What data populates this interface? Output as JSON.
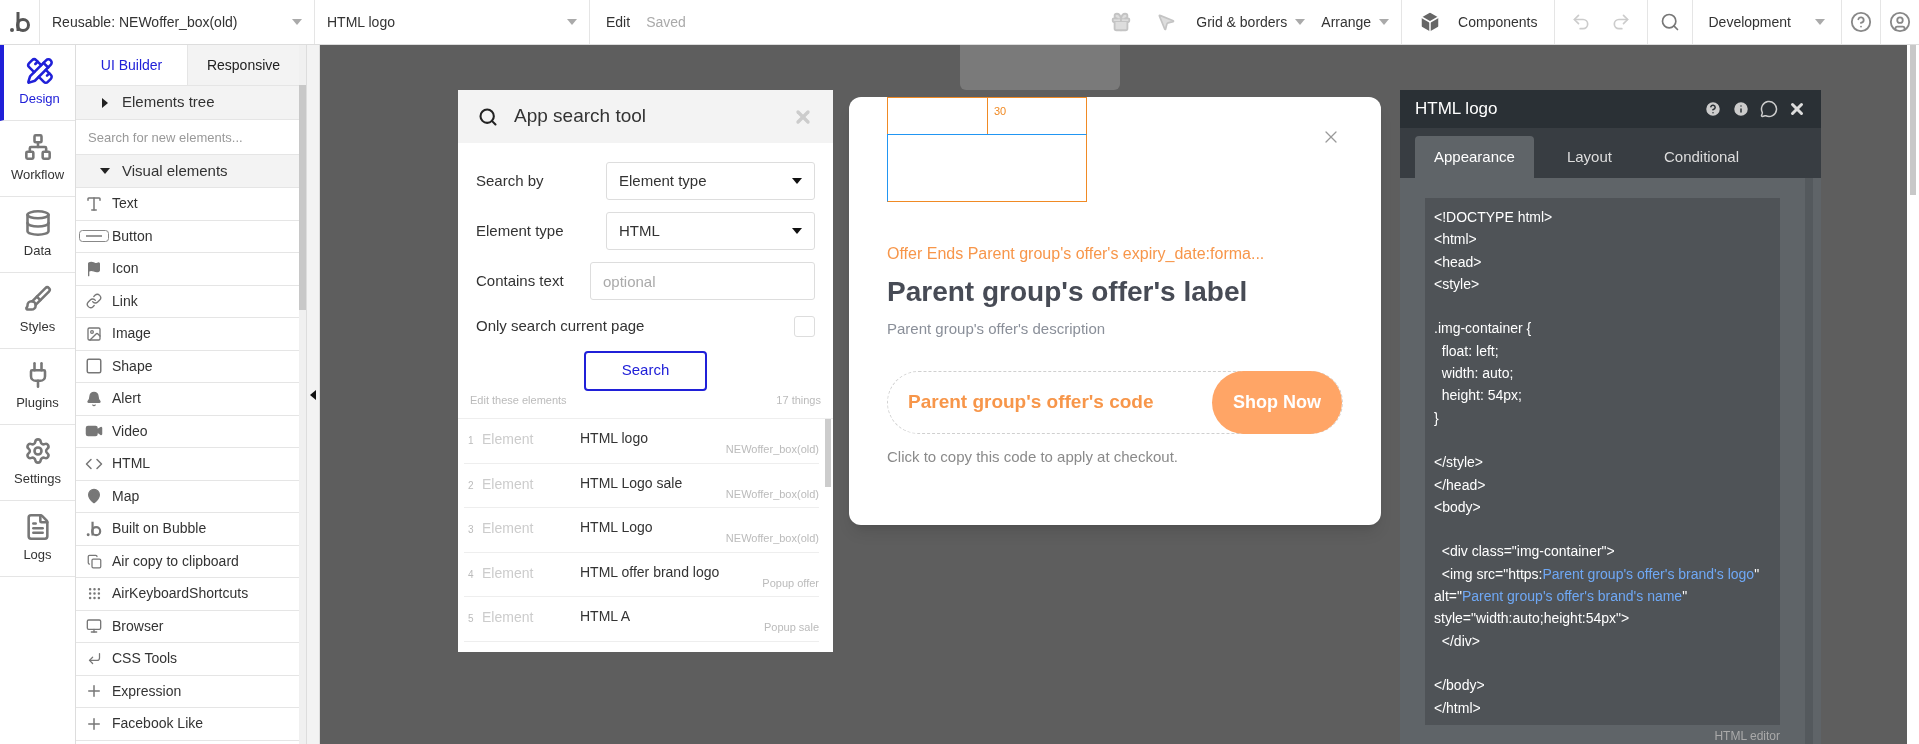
{
  "top_bar": {
    "reusable_dropdown": "Reusable: NEWoffer_box(old)",
    "element_dropdown": "HTML logo",
    "edit": "Edit",
    "save_status": "Saved",
    "grid_menu": "Grid & borders",
    "arrange_menu": "Arrange",
    "components": "Components",
    "environment": "Development"
  },
  "rail": [
    {
      "label": "Design",
      "selected": true
    },
    {
      "label": "Workflow",
      "selected": false
    },
    {
      "label": "Data",
      "selected": false
    },
    {
      "label": "Styles",
      "selected": false
    },
    {
      "label": "Plugins",
      "selected": false
    },
    {
      "label": "Settings",
      "selected": false
    },
    {
      "label": "Logs",
      "selected": false
    }
  ],
  "panel": {
    "tabs": [
      {
        "label": "UI Builder",
        "selected": true
      },
      {
        "label": "Responsive",
        "selected": false
      }
    ],
    "elements_tree": {
      "label": "Elements tree",
      "expanded": false
    },
    "element_search": {
      "placeholder": "Search for new elements..."
    },
    "visual_elements": {
      "label": "Visual elements",
      "expanded": true,
      "items": [
        "Text",
        "Button",
        "Icon",
        "Link",
        "Image",
        "Shape",
        "Alert",
        "Video",
        "HTML",
        "Map",
        "Built on Bubble",
        "Air copy to clipboard",
        "AirKeyboardShortcuts",
        "Browser",
        "CSS Tools",
        "Expression",
        "Facebook Like"
      ]
    }
  },
  "search_tool": {
    "title": "App search tool",
    "fields": [
      {
        "kind": "select",
        "label": "Search by",
        "value": "Element type"
      },
      {
        "kind": "select",
        "label": "Element type",
        "value": "HTML"
      },
      {
        "kind": "text",
        "label": "Contains text",
        "placeholder": "optional"
      }
    ],
    "current_page_only": {
      "label": "Only search current page",
      "checked": false
    },
    "search_button": "Search",
    "results_caption": "Edit these elements",
    "results_count": "17 things",
    "results": [
      {
        "number": "1",
        "type": "Element",
        "name": "HTML logo",
        "source": "NEWoffer_box(old)"
      },
      {
        "number": "2",
        "type": "Element",
        "name": "HTML Logo sale",
        "source": "NEWoffer_box(old)"
      },
      {
        "number": "3",
        "type": "Element",
        "name": "HTML Logo",
        "source": "NEWoffer_box(old)"
      },
      {
        "number": "4",
        "type": "Element",
        "name": "HTML offer brand logo",
        "source": "Popup offer"
      },
      {
        "number": "5",
        "type": "Element",
        "name": "HTML A",
        "source": "Popup sale"
      }
    ]
  },
  "popup": {
    "outline_label": "30",
    "expiry": "Offer Ends Parent group's offer's expiry_date:forma...",
    "title": "Parent group's offer's label",
    "description": "Parent group's offer's description",
    "code": "Parent group's offer's code",
    "button": "Shop Now",
    "hint": "Click to copy this code to apply at checkout."
  },
  "property_editor": {
    "title": "HTML logo",
    "tabs": [
      {
        "label": "Appearance",
        "selected": true
      },
      {
        "label": "Layout",
        "selected": false
      },
      {
        "label": "Conditional",
        "selected": false
      }
    ],
    "code_lines": [
      {
        "kind": "code",
        "segments": [
          {
            "kind": "plain",
            "text": "<!DOCTYPE html>"
          }
        ]
      },
      {
        "kind": "code",
        "segments": [
          {
            "kind": "plain",
            "text": "<html>"
          }
        ]
      },
      {
        "kind": "code",
        "segments": [
          {
            "kind": "plain",
            "text": "<head>"
          }
        ]
      },
      {
        "kind": "code",
        "segments": [
          {
            "kind": "plain",
            "text": "<style>"
          }
        ]
      },
      {
        "kind": "blank"
      },
      {
        "kind": "code",
        "segments": [
          {
            "kind": "plain",
            "text": ".img-container {"
          }
        ]
      },
      {
        "kind": "code",
        "segments": [
          {
            "kind": "plain",
            "text": "  float: left;"
          }
        ]
      },
      {
        "kind": "code",
        "segments": [
          {
            "kind": "plain",
            "text": "  width: auto;"
          }
        ]
      },
      {
        "kind": "code",
        "segments": [
          {
            "kind": "plain",
            "text": "  height: 54px;"
          }
        ]
      },
      {
        "kind": "code",
        "segments": [
          {
            "kind": "plain",
            "text": "}"
          }
        ]
      },
      {
        "kind": "blank"
      },
      {
        "kind": "code",
        "segments": [
          {
            "kind": "plain",
            "text": "</style>"
          }
        ]
      },
      {
        "kind": "code",
        "segments": [
          {
            "kind": "plain",
            "text": "</head>"
          }
        ]
      },
      {
        "kind": "code",
        "segments": [
          {
            "kind": "plain",
            "text": "<body>"
          }
        ]
      },
      {
        "kind": "blank"
      },
      {
        "kind": "code",
        "segments": [
          {
            "kind": "plain",
            "text": "  <div class=\"img-container\">"
          }
        ]
      },
      {
        "kind": "code",
        "segments": [
          {
            "kind": "plain",
            "text": "  <img src=\"https:"
          },
          {
            "kind": "dynamic",
            "text": "Parent group's offer's brand's logo"
          },
          {
            "kind": "plain",
            "text": "\" alt=\""
          },
          {
            "kind": "dynamic",
            "text": "Parent group's offer's brand's name"
          },
          {
            "kind": "plain",
            "text": "\" style=\"width:auto;height:54px\">"
          }
        ]
      },
      {
        "kind": "code",
        "segments": [
          {
            "kind": "plain",
            "text": "  </div>"
          }
        ]
      },
      {
        "kind": "blank"
      },
      {
        "kind": "code",
        "segments": [
          {
            "kind": "plain",
            "text": "</body>"
          }
        ]
      },
      {
        "kind": "code",
        "segments": [
          {
            "kind": "plain",
            "text": "</html>"
          }
        ]
      }
    ],
    "footer": "HTML editor"
  }
}
